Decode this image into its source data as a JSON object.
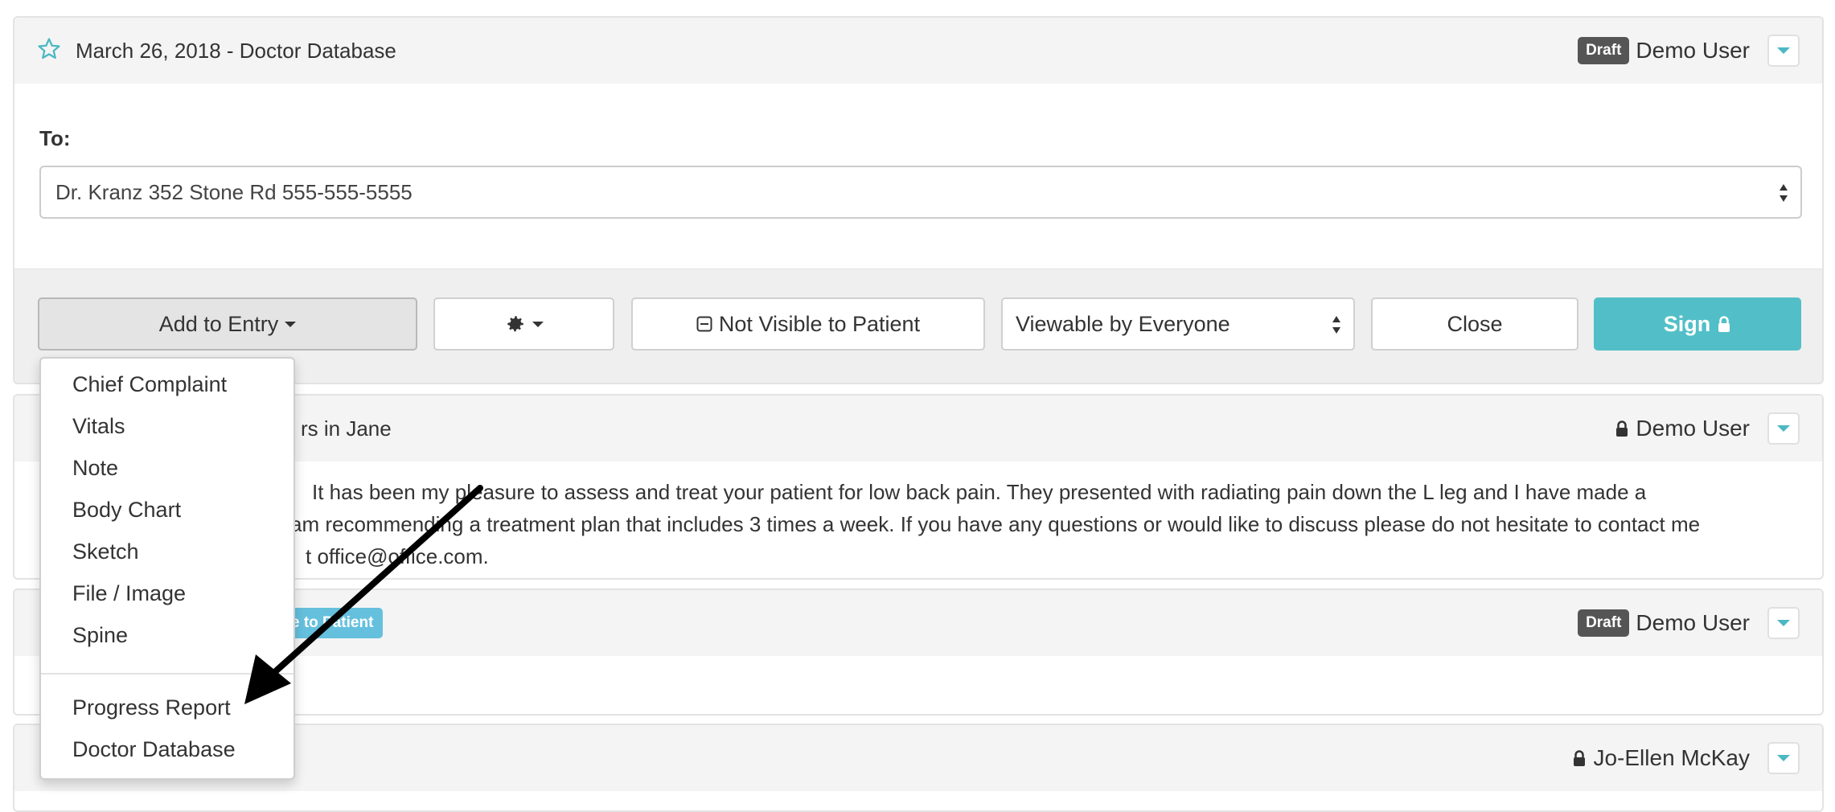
{
  "entry_top": {
    "title": "March 26, 2018 - Doctor Database",
    "badge": "Draft",
    "author": "Demo User",
    "to_label": "To:",
    "to_value": "Dr. Kranz 352 Stone Rd 555-555-5555"
  },
  "toolbar": {
    "add_to_entry": "Add to Entry",
    "not_visible": "Not Visible to Patient",
    "viewable": "Viewable by Everyone",
    "close": "Close",
    "sign": "Sign"
  },
  "entry_2": {
    "title_partial": "rs in Jane",
    "author": "Demo User",
    "text_lines": [
      "It has been my pleasure to assess and treat your patient for low back pain. They presented with radiating pain down the L leg and I have made a",
      "am recommending a treatment plan that includes 3 times a week. If you have any questions or would like to discuss please do not hesitate to contact me",
      "t office@office.com."
    ]
  },
  "entry_3": {
    "pill_partial": "e to Patient",
    "badge": "Draft",
    "author": "Demo User"
  },
  "entry_4": {
    "author": "Jo-Ellen McKay"
  },
  "dropdown": {
    "items": [
      "Chief Complaint",
      "Vitals",
      "Note",
      "Body Chart",
      "Sketch",
      "File / Image",
      "Spine"
    ],
    "items2": [
      "Progress Report",
      "Doctor Database"
    ]
  },
  "colors": {
    "accent": "#52bfc8",
    "badge_dark": "#555555",
    "pill_blue": "#65c0de"
  },
  "icons": [
    "star-icon",
    "gear-icon",
    "lock-icon",
    "minus-box-icon",
    "chevron-down-icon",
    "updown-icon",
    "arrow-annotation"
  ]
}
